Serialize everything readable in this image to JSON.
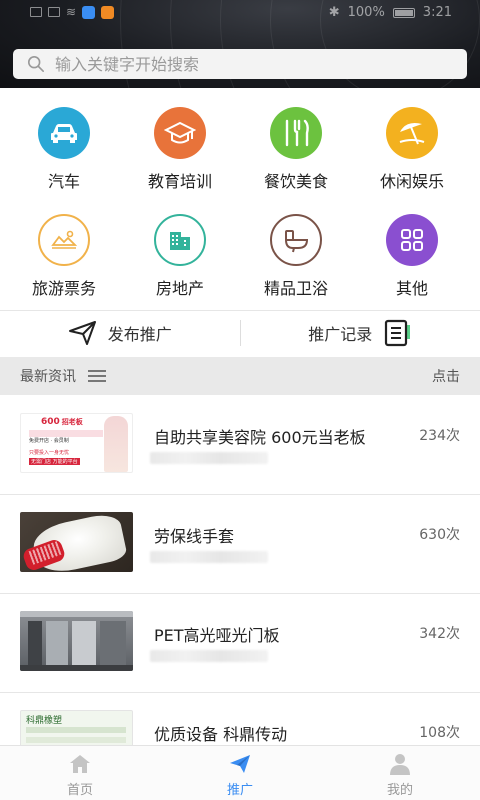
{
  "status": {
    "battery": "100%",
    "time": "3:21"
  },
  "search": {
    "placeholder": "输入关键字开始搜索"
  },
  "categories": [
    {
      "label": "汽车",
      "icon": "car-icon",
      "color": "#2aa8d6"
    },
    {
      "label": "教育培训",
      "icon": "graduation-cap-icon",
      "color": "#e8733a"
    },
    {
      "label": "餐饮美食",
      "icon": "fork-knife-icon",
      "color": "#6cc23f"
    },
    {
      "label": "休闲娱乐",
      "icon": "beach-umbrella-icon",
      "color": "#f3b11f"
    },
    {
      "label": "旅游票务",
      "icon": "ticket-icon",
      "color": "#f1b24a"
    },
    {
      "label": "房地产",
      "icon": "building-icon",
      "color": "#33b39b"
    },
    {
      "label": "精品卫浴",
      "icon": "toilet-icon",
      "color": "#7a5348"
    },
    {
      "label": "其他",
      "icon": "grid-icon",
      "color": "#8a4fd0"
    }
  ],
  "actions": {
    "publish": "发布推广",
    "records": "推广记录"
  },
  "news_header": {
    "title": "最新资讯",
    "right": "点击"
  },
  "news": [
    {
      "title": "自助共享美容院 600元当老板",
      "count": "234次"
    },
    {
      "title": "劳保线手套",
      "count": "630次"
    },
    {
      "title": "PET高光哑光门板",
      "count": "342次"
    },
    {
      "title": "优质设备 科鼎传动",
      "count": "108次"
    }
  ],
  "thumb_text": {
    "ad_price": "600",
    "ad_title": "招老板",
    "ad_line1": "免费开店 · 会员制",
    "ad_line2": "只要投入一身无忧",
    "ad_line3": "无需门店 万能的平台",
    "brand": "科鼎橡塑"
  },
  "tabs": [
    {
      "label": "首页",
      "icon": "home-icon",
      "active": false
    },
    {
      "label": "推广",
      "icon": "paper-plane-icon",
      "active": true
    },
    {
      "label": "我的",
      "icon": "user-icon",
      "active": false
    }
  ],
  "colors": {
    "accent": "#3a8df2"
  }
}
